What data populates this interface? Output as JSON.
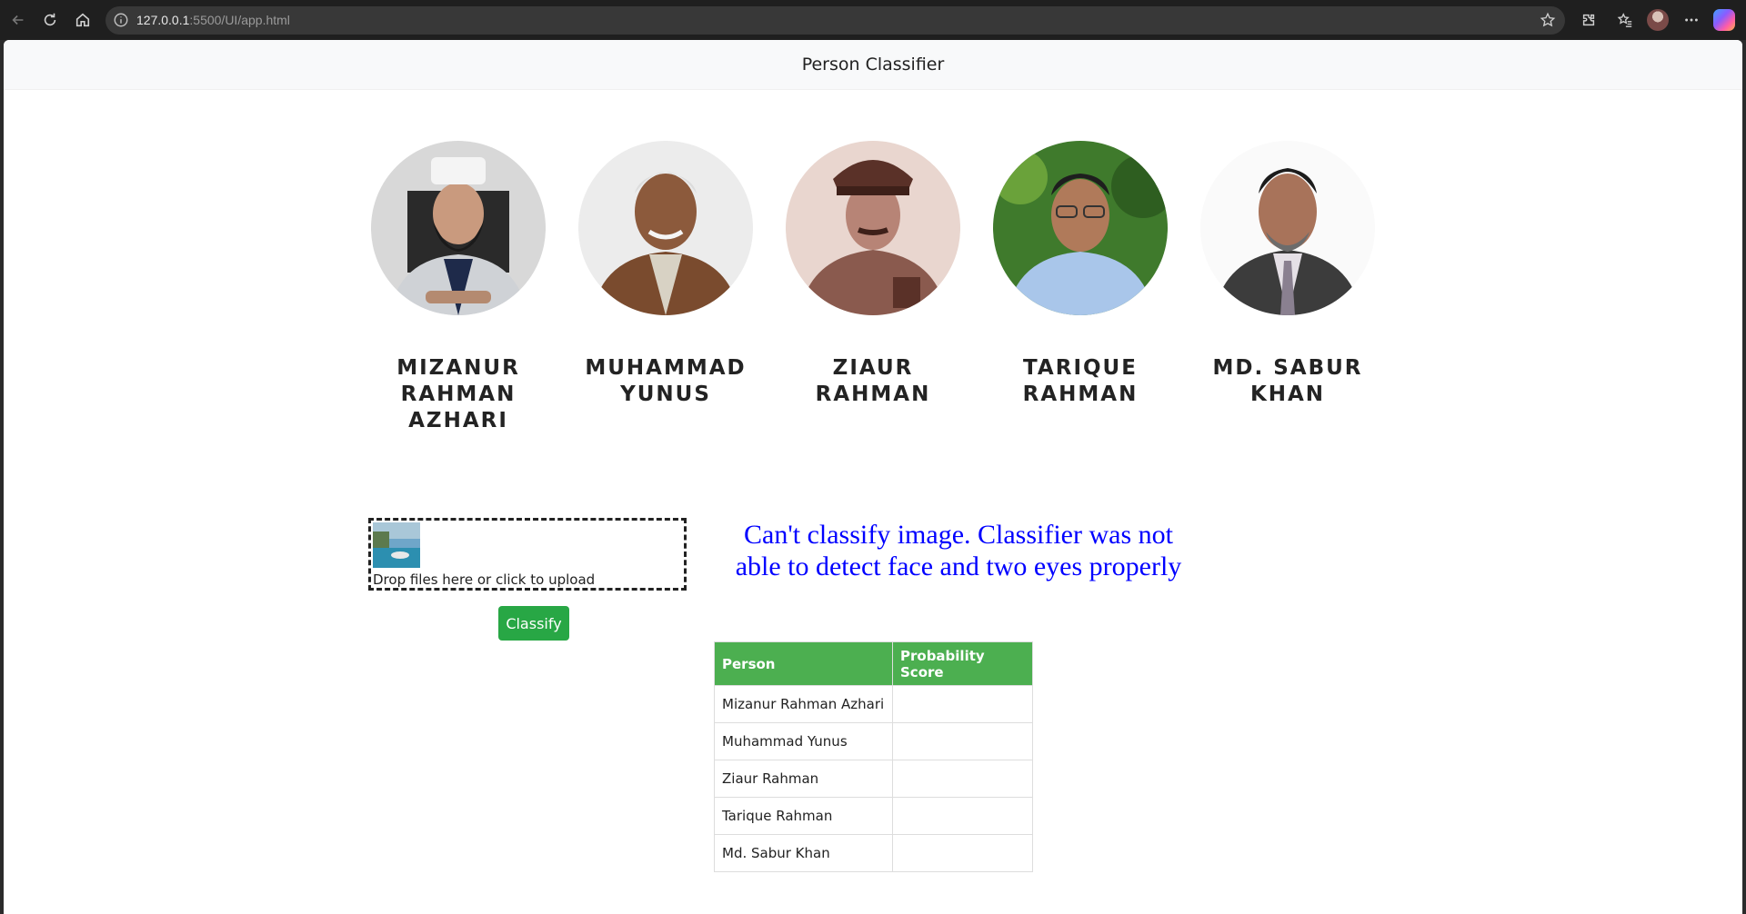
{
  "browser": {
    "url_host": "127.0.0.1",
    "url_rest": ":5500/UI/app.html"
  },
  "header": {
    "title": "Person Classifier"
  },
  "persons": [
    {
      "name": "Mizanur Rahman Azhari"
    },
    {
      "name": "Muhammad Yunus"
    },
    {
      "name": "Ziaur Rahman"
    },
    {
      "name": "Tarique Rahman"
    },
    {
      "name": "Md. Sabur Khan"
    }
  ],
  "upload": {
    "message": "Drop files here or click to upload"
  },
  "classify_label": "Classify",
  "error_message": "Can't classify image. Classifier was not able to detect face and two eyes properly",
  "table": {
    "headers": [
      "Person",
      "Probability Score"
    ],
    "rows": [
      {
        "person": "Mizanur Rahman Azhari",
        "score": ""
      },
      {
        "person": "Muhammad Yunus",
        "score": ""
      },
      {
        "person": "Ziaur Rahman",
        "score": ""
      },
      {
        "person": "Tarique Rahman",
        "score": ""
      },
      {
        "person": "Md. Sabur Khan",
        "score": ""
      }
    ]
  }
}
